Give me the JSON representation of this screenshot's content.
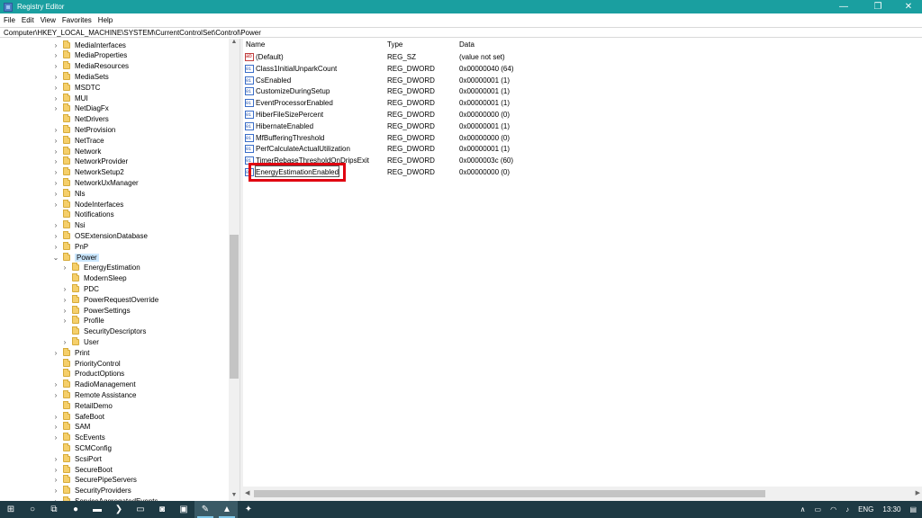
{
  "window": {
    "title": "Registry Editor",
    "minimize_label": "—",
    "maximize_label": "❐",
    "close_label": "✕"
  },
  "menu": [
    "File",
    "Edit",
    "View",
    "Favorites",
    "Help"
  ],
  "address": "Computer\\HKEY_LOCAL_MACHINE\\SYSTEM\\CurrentControlSet\\Control\\Power",
  "tree": [
    {
      "label": "MediaInterfaces",
      "depth": 0,
      "chevron": "›"
    },
    {
      "label": "MediaProperties",
      "depth": 0,
      "chevron": "›"
    },
    {
      "label": "MediaResources",
      "depth": 0,
      "chevron": "›"
    },
    {
      "label": "MediaSets",
      "depth": 0,
      "chevron": "›"
    },
    {
      "label": "MSDTC",
      "depth": 0,
      "chevron": "›"
    },
    {
      "label": "MUI",
      "depth": 0,
      "chevron": "›"
    },
    {
      "label": "NetDiagFx",
      "depth": 0,
      "chevron": "›"
    },
    {
      "label": "NetDrivers",
      "depth": 0,
      "chevron": ""
    },
    {
      "label": "NetProvision",
      "depth": 0,
      "chevron": "›"
    },
    {
      "label": "NetTrace",
      "depth": 0,
      "chevron": "›"
    },
    {
      "label": "Network",
      "depth": 0,
      "chevron": "›"
    },
    {
      "label": "NetworkProvider",
      "depth": 0,
      "chevron": "›"
    },
    {
      "label": "NetworkSetup2",
      "depth": 0,
      "chevron": "›"
    },
    {
      "label": "NetworkUxManager",
      "depth": 0,
      "chevron": "›"
    },
    {
      "label": "Nls",
      "depth": 0,
      "chevron": "›"
    },
    {
      "label": "NodeInterfaces",
      "depth": 0,
      "chevron": "›"
    },
    {
      "label": "Notifications",
      "depth": 0,
      "chevron": ""
    },
    {
      "label": "Nsi",
      "depth": 0,
      "chevron": "›"
    },
    {
      "label": "OSExtensionDatabase",
      "depth": 0,
      "chevron": "›"
    },
    {
      "label": "PnP",
      "depth": 0,
      "chevron": "›"
    },
    {
      "label": "Power",
      "depth": 0,
      "chevron": "⌄",
      "selected": true
    },
    {
      "label": "EnergyEstimation",
      "depth": 1,
      "chevron": "›"
    },
    {
      "label": "ModernSleep",
      "depth": 1,
      "chevron": ""
    },
    {
      "label": "PDC",
      "depth": 1,
      "chevron": "›"
    },
    {
      "label": "PowerRequestOverride",
      "depth": 1,
      "chevron": "›"
    },
    {
      "label": "PowerSettings",
      "depth": 1,
      "chevron": "›"
    },
    {
      "label": "Profile",
      "depth": 1,
      "chevron": "›"
    },
    {
      "label": "SecurityDescriptors",
      "depth": 1,
      "chevron": ""
    },
    {
      "label": "User",
      "depth": 1,
      "chevron": "›"
    },
    {
      "label": "Print",
      "depth": 0,
      "chevron": "›"
    },
    {
      "label": "PriorityControl",
      "depth": 0,
      "chevron": ""
    },
    {
      "label": "ProductOptions",
      "depth": 0,
      "chevron": ""
    },
    {
      "label": "RadioManagement",
      "depth": 0,
      "chevron": "›"
    },
    {
      "label": "Remote Assistance",
      "depth": 0,
      "chevron": "›"
    },
    {
      "label": "RetailDemo",
      "depth": 0,
      "chevron": ""
    },
    {
      "label": "SafeBoot",
      "depth": 0,
      "chevron": "›"
    },
    {
      "label": "SAM",
      "depth": 0,
      "chevron": "›"
    },
    {
      "label": "ScEvents",
      "depth": 0,
      "chevron": "›"
    },
    {
      "label": "SCMConfig",
      "depth": 0,
      "chevron": ""
    },
    {
      "label": "ScsiPort",
      "depth": 0,
      "chevron": "›"
    },
    {
      "label": "SecureBoot",
      "depth": 0,
      "chevron": "›"
    },
    {
      "label": "SecurePipeServers",
      "depth": 0,
      "chevron": "›"
    },
    {
      "label": "SecurityProviders",
      "depth": 0,
      "chevron": "›"
    },
    {
      "label": "ServiceAggregatedEvents",
      "depth": 0,
      "chevron": "›"
    }
  ],
  "columns": {
    "name": "Name",
    "type": "Type",
    "data": "Data"
  },
  "values": [
    {
      "name": "(Default)",
      "type": "REG_SZ",
      "data": "(value not set)",
      "icon": "string-value-icon"
    },
    {
      "name": "Class1InitialUnparkCount",
      "type": "REG_DWORD",
      "data": "0x00000040 (64)",
      "icon": "dword-value-icon"
    },
    {
      "name": "CsEnabled",
      "type": "REG_DWORD",
      "data": "0x00000001 (1)",
      "icon": "dword-value-icon"
    },
    {
      "name": "CustomizeDuringSetup",
      "type": "REG_DWORD",
      "data": "0x00000001 (1)",
      "icon": "dword-value-icon"
    },
    {
      "name": "EventProcessorEnabled",
      "type": "REG_DWORD",
      "data": "0x00000001 (1)",
      "icon": "dword-value-icon"
    },
    {
      "name": "HiberFileSizePercent",
      "type": "REG_DWORD",
      "data": "0x00000000 (0)",
      "icon": "dword-value-icon"
    },
    {
      "name": "HibernateEnabled",
      "type": "REG_DWORD",
      "data": "0x00000001 (1)",
      "icon": "dword-value-icon"
    },
    {
      "name": "MfBufferingThreshold",
      "type": "REG_DWORD",
      "data": "0x00000000 (0)",
      "icon": "dword-value-icon"
    },
    {
      "name": "PerfCalculateActualUtilization",
      "type": "REG_DWORD",
      "data": "0x00000001 (1)",
      "icon": "dword-value-icon"
    },
    {
      "name": "TimerRebaseThresholdOnDripsExit",
      "type": "REG_DWORD",
      "data": "0x0000003c (60)",
      "icon": "dword-value-icon"
    },
    {
      "name": "EnergyEstimationEnabled",
      "type": "REG_DWORD",
      "data": "0x00000000 (0)",
      "icon": "dword-value-icon",
      "editing": true
    }
  ],
  "taskbar": {
    "items": [
      "start",
      "search",
      "task-view",
      "firefox",
      "terminal",
      "powershell",
      "file-explorer",
      "app-1",
      "app-2",
      "app-3",
      "photos",
      "app-4"
    ],
    "tray": {
      "chevron": "∧",
      "language": "ENG",
      "time": "13:30"
    }
  }
}
